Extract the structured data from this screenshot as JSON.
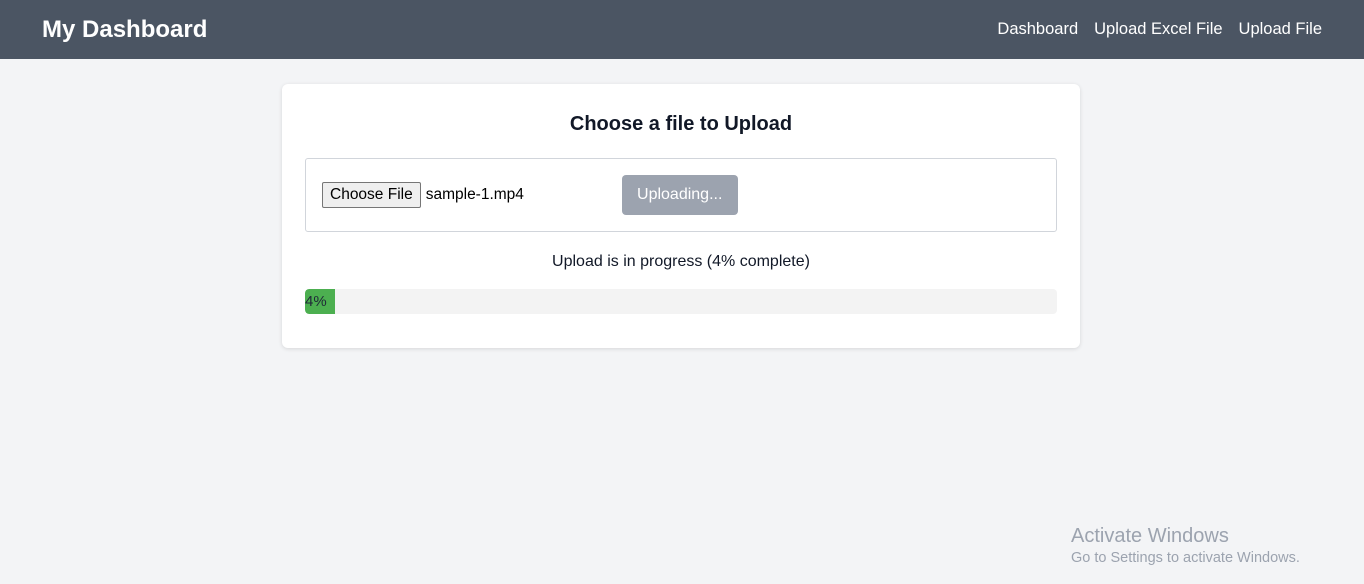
{
  "nav": {
    "brand": "My Dashboard",
    "links": [
      {
        "label": "Dashboard"
      },
      {
        "label": "Upload Excel File"
      },
      {
        "label": "Upload File"
      }
    ]
  },
  "card": {
    "title": "Choose a file to Upload",
    "file_button_label": "Choose File",
    "file_name": "sample-1.mp4",
    "upload_button_label": "Uploading...",
    "status_text": "Upload is in progress (4% complete)",
    "progress": {
      "percent": 4,
      "label": "4%",
      "fill_color": "#4caf50"
    }
  },
  "watermark": {
    "title": "Activate Windows",
    "subtitle": "Go to Settings to activate Windows."
  }
}
